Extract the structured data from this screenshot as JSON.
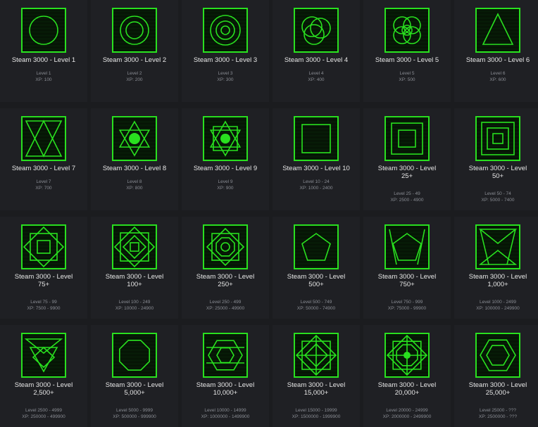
{
  "badges": [
    {
      "title": "Steam 3000 - Level 1",
      "level": "Level 1",
      "xp": "XP: 100",
      "icon": "circle-icon"
    },
    {
      "title": "Steam 3000 - Level 2",
      "level": "Level 2",
      "xp": "XP: 200",
      "icon": "double-circle-icon"
    },
    {
      "title": "Steam 3000 - Level 3",
      "level": "Level 3",
      "xp": "XP: 300",
      "icon": "triple-circle-icon"
    },
    {
      "title": "Steam 3000 - Level 4",
      "level": "Level 4",
      "xp": "XP: 400",
      "icon": "overlapping-circles-icon"
    },
    {
      "title": "Steam 3000 - Level 5",
      "level": "Level 5",
      "xp": "XP: 500",
      "icon": "four-circles-icon"
    },
    {
      "title": "Steam 3000 - Level 6",
      "level": "Level 6",
      "xp": "XP: 600",
      "icon": "triangle-icon"
    },
    {
      "title": "Steam 3000 - Level 7",
      "level": "Level 7",
      "xp": "XP: 700",
      "icon": "hourglass-icon"
    },
    {
      "title": "Steam 3000 - Level 8",
      "level": "Level 8",
      "xp": "XP: 800",
      "icon": "star-circle-icon"
    },
    {
      "title": "Steam 3000 - Level 9",
      "level": "Level 9",
      "xp": "XP: 900",
      "icon": "hexagram-icon"
    },
    {
      "title": "Steam 3000 - Level 10",
      "level": "Level 10 - 24",
      "xp": "XP: 1000 - 2400",
      "icon": "square-icon"
    },
    {
      "title": "Steam 3000 - Level 25+",
      "level": "Level 25 - 49",
      "xp": "XP: 2500 - 4900",
      "icon": "double-square-icon"
    },
    {
      "title": "Steam 3000 - Level 50+",
      "level": "Level 50 - 74",
      "xp": "XP: 5000 - 7400",
      "icon": "triple-square-icon"
    },
    {
      "title": "Steam 3000 - Level 75+",
      "level": "Level 75 - 99",
      "xp": "XP: 7500 - 9900",
      "icon": "rotated-squares-icon"
    },
    {
      "title": "Steam 3000 - Level 100+",
      "level": "Level 100 - 249",
      "xp": "XP: 10000 - 24900",
      "icon": "diamond-squares-icon"
    },
    {
      "title": "Steam 3000 - Level 250+",
      "level": "Level 250 - 499",
      "xp": "XP: 25000 - 49900",
      "icon": "octagram-circle-icon"
    },
    {
      "title": "Steam 3000 - Level 500+",
      "level": "Level 500 - 749",
      "xp": "XP: 50000 - 74900",
      "icon": "pentagon-icon"
    },
    {
      "title": "Steam 3000 - Level 750+",
      "level": "Level 750 - 999",
      "xp": "XP: 75000 - 99900",
      "icon": "pentagon-frame-icon"
    },
    {
      "title": "Steam 3000 - Level 1,000+",
      "level": "Level 1000 - 2499",
      "xp": "XP: 100000 - 249900",
      "icon": "bowtie-icon"
    },
    {
      "title": "Steam 3000 - Level 2,500+",
      "level": "Level 2500 - 4999",
      "xp": "XP: 250000 - 499900",
      "icon": "shield-icon"
    },
    {
      "title": "Steam 3000 - Level 5,000+",
      "level": "Level 5000 - 9999",
      "xp": "XP: 500000 - 999900",
      "icon": "octagon-icon"
    },
    {
      "title": "Steam 3000 - Level 10,000+",
      "level": "Level 10000 - 14999",
      "xp": "XP: 1000000 - 1499900",
      "icon": "hex-bands-icon"
    },
    {
      "title": "Steam 3000 - Level 15,000+",
      "level": "Level 15000 - 19999",
      "xp": "XP: 1500000 - 1999900",
      "icon": "diamond-lattice-icon"
    },
    {
      "title": "Steam 3000 - Level 20,000+",
      "level": "Level 20000 - 24999",
      "xp": "XP: 2000000 - 2499900",
      "icon": "star-lattice-icon"
    },
    {
      "title": "Steam 3000 - Level 25,000+",
      "level": "Level 25000 - ???",
      "xp": "XP: 2500000 - ???",
      "icon": "nested-hexagons-icon"
    }
  ],
  "colors": {
    "accent": "#29e01f",
    "background": "#1b1c1f",
    "card": "#1f2024",
    "title": "#e6e6e6",
    "meta": "#8a8d94"
  }
}
